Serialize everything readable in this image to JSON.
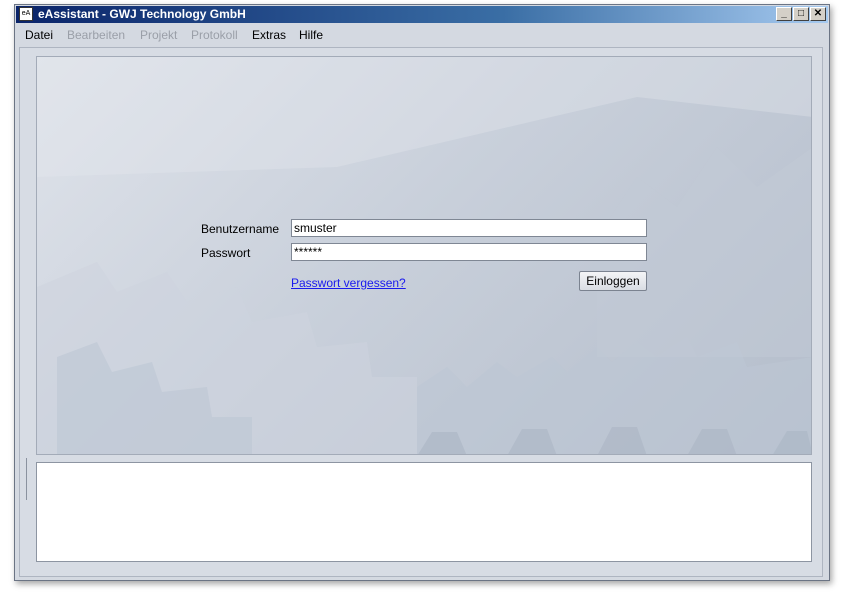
{
  "window": {
    "title": "eAssistant - GWJ Technology GmbH",
    "app_icon_text": "eA",
    "controls": {
      "minimize": "_",
      "maximize": "□",
      "close": "✕"
    }
  },
  "menu": [
    {
      "label": "Datei",
      "enabled": true
    },
    {
      "label": "Bearbeiten",
      "enabled": false
    },
    {
      "label": "Projekt",
      "enabled": false
    },
    {
      "label": "Protokoll",
      "enabled": false
    },
    {
      "label": "Extras",
      "enabled": true
    },
    {
      "label": "Hilfe",
      "enabled": true
    }
  ],
  "login": {
    "username_label": "Benutzername",
    "username_value": "smuster",
    "password_label": "Passwort",
    "password_value": "******",
    "forgot_link": "Passwort vergessen?",
    "login_button": "Einloggen"
  },
  "log_panel": {
    "text": ""
  },
  "colors": {
    "titlebar_start": "#0a246a",
    "titlebar_end": "#a6caf0",
    "link": "#1a1aee",
    "window_bg": "#d4d9e1"
  }
}
